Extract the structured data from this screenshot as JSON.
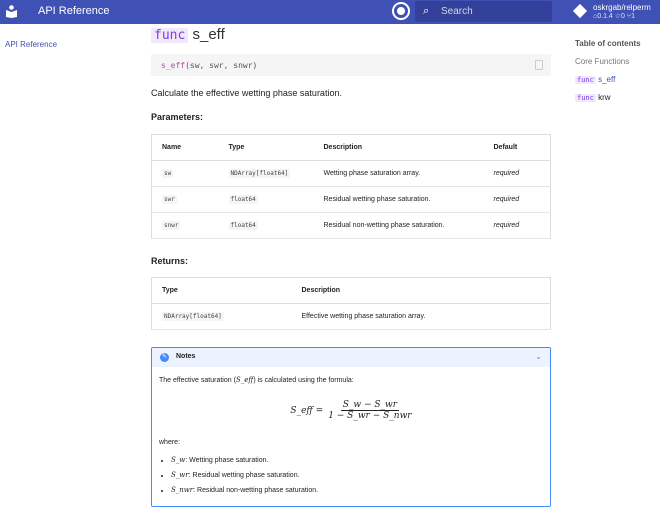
{
  "header": {
    "title": "API Reference",
    "search_placeholder": "Search",
    "repo": {
      "name": "oskrgab/relperm",
      "version": "0.1.4",
      "stars": "0",
      "forks": "1"
    }
  },
  "nav": {
    "item": "API Reference"
  },
  "main": {
    "keyword": "func",
    "name": "s_eff",
    "signature": {
      "fn": "s_eff",
      "args": "(sw, swr, snwr)"
    },
    "summary": "Calculate the effective wetting phase saturation.",
    "parameters_title": "Parameters:",
    "parameters": {
      "headers": [
        "Name",
        "Type",
        "Description",
        "Default"
      ],
      "rows": [
        [
          "sw",
          "NDArray[float64]",
          "Wetting phase saturation array.",
          "required"
        ],
        [
          "swr",
          "float64",
          "Residual wetting phase saturation.",
          "required"
        ],
        [
          "snwr",
          "float64",
          "Residual non-wetting phase saturation.",
          "required"
        ]
      ]
    },
    "returns_title": "Returns:",
    "returns": {
      "headers": [
        "Type",
        "Description"
      ],
      "rows": [
        [
          "NDArray[float64]",
          "Effective wetting phase saturation array."
        ]
      ]
    },
    "notes": {
      "title": "Notes",
      "intro_before": "The effective saturation (",
      "intro_sym": "S_eff",
      "intro_after": ") is calculated using the formula:",
      "formula": {
        "lhs": "S_eff =",
        "num": "S_w − S_wr",
        "den": "1 − S_wr − S_nwr"
      },
      "where": "where:",
      "items": [
        {
          "sym": "S_w",
          "text": ": Wetting phase saturation."
        },
        {
          "sym": "S_wr",
          "text": ": Residual wetting phase saturation."
        },
        {
          "sym": "S_nwr",
          "text": ": Residual non-wetting phase saturation."
        }
      ]
    }
  },
  "toc": {
    "title": "Table of contents",
    "section": "Core Functions",
    "items": [
      {
        "kw": "func",
        "name": "s_eff"
      },
      {
        "kw": "func",
        "name": "krw"
      }
    ]
  },
  "colors": {
    "primary": "#3f51b5",
    "accent": "#448aff",
    "keyword": "#7c3aed"
  }
}
